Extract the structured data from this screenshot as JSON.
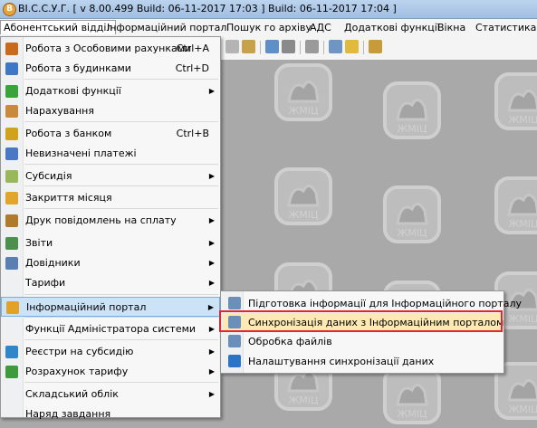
{
  "window": {
    "app_icon_letter": "В",
    "title": "ВІ.С.С.У.Г. [ v 8.00.499 Build: 06-11-2017 17:03 ]   Build: 06-11-2017 17:04 ]"
  },
  "menubar": [
    {
      "label": "Абонентський відділ"
    },
    {
      "label": "Інформаційний портал"
    },
    {
      "label": "Пошук го архіву"
    },
    {
      "label": "АДС"
    },
    {
      "label": "Додаткові функції"
    },
    {
      "label": "Вікна"
    },
    {
      "label": "Статистика"
    }
  ],
  "dropdown": [
    {
      "label": "Робота з Особовими рахунками",
      "shortcut": "Ctrl+A",
      "icon": "people-icon",
      "color": "#c76a1d"
    },
    {
      "label": "Робота з будинками",
      "shortcut": "Ctrl+D",
      "icon": "house-icon",
      "color": "#3f77c6"
    },
    {
      "label": "Додаткові функції",
      "arrow": "▶",
      "icon": "plus-icon",
      "color": "#3aa33a"
    },
    {
      "label": "Нарахування",
      "icon": "calculator-icon",
      "color": "#c98a3b"
    },
    {
      "label": "Робота з банком",
      "shortcut": "Ctrl+B",
      "icon": "dollar-icon",
      "color": "#d1a21b"
    },
    {
      "label": "Невизначені платежі",
      "icon": "money-question-icon",
      "color": "#4a78c4"
    },
    {
      "label": "Субсидія",
      "arrow": "▶",
      "icon": "tag-icon",
      "color": "#98b85a"
    },
    {
      "label": "Закриття місяця",
      "icon": "clock-icon",
      "color": "#e0a52a"
    },
    {
      "label": "Друк повідомлень на сплату",
      "arrow": "▶",
      "icon": "print-icon",
      "color": "#b07a2c"
    },
    {
      "label": "Звіти",
      "arrow": "▶",
      "icon": "report-icon",
      "color": "#4d8f4d"
    },
    {
      "label": "Довідники",
      "arrow": "▶",
      "icon": "book-icon",
      "color": "#5a7fb0"
    },
    {
      "label": "Тарифи",
      "arrow": "▶",
      "icon": "",
      "color": ""
    },
    {
      "label": "Інформаційний портал",
      "arrow": "▶",
      "icon": "globe-icon",
      "color": "#e3a126",
      "highlight": true
    },
    {
      "label": "Функції Адміністратора системи",
      "arrow": "▶",
      "icon": "",
      "color": ""
    },
    {
      "label": "Реєстри на субсидію",
      "arrow": "▶",
      "icon": "registry-icon",
      "color": "#2f86c9"
    },
    {
      "label": "Розрахунок тарифу",
      "arrow": "▶",
      "icon": "money-bag-icon",
      "color": "#3d9a3d"
    },
    {
      "label": "Складський облік",
      "arrow": "▶",
      "icon": "",
      "color": ""
    },
    {
      "label": "Наряд завдання",
      "icon": "",
      "color": ""
    }
  ],
  "submenu": [
    {
      "label": "Підготовка інформації для Інформаційного порталу",
      "icon": "prepare-icon",
      "color": "#6b8fb8"
    },
    {
      "label": "Синхронізація даних з Інформаційним порталом",
      "icon": "sync-icon",
      "color": "#6b8fb8",
      "highlight": true
    },
    {
      "label": "Обробка файлів",
      "icon": "files-icon",
      "color": "#6b8fb8"
    },
    {
      "label": "Налаштування синхронізації даних",
      "icon": "settings-globe-icon",
      "color": "#2a73c7"
    }
  ],
  "watermark": {
    "text": "ЖМІЦ"
  },
  "colors": {
    "highlight": "#cce3f7",
    "submenu_highlight": "#fce9b3",
    "frame": "#e3262d",
    "workspace": "#a9a9a9"
  }
}
